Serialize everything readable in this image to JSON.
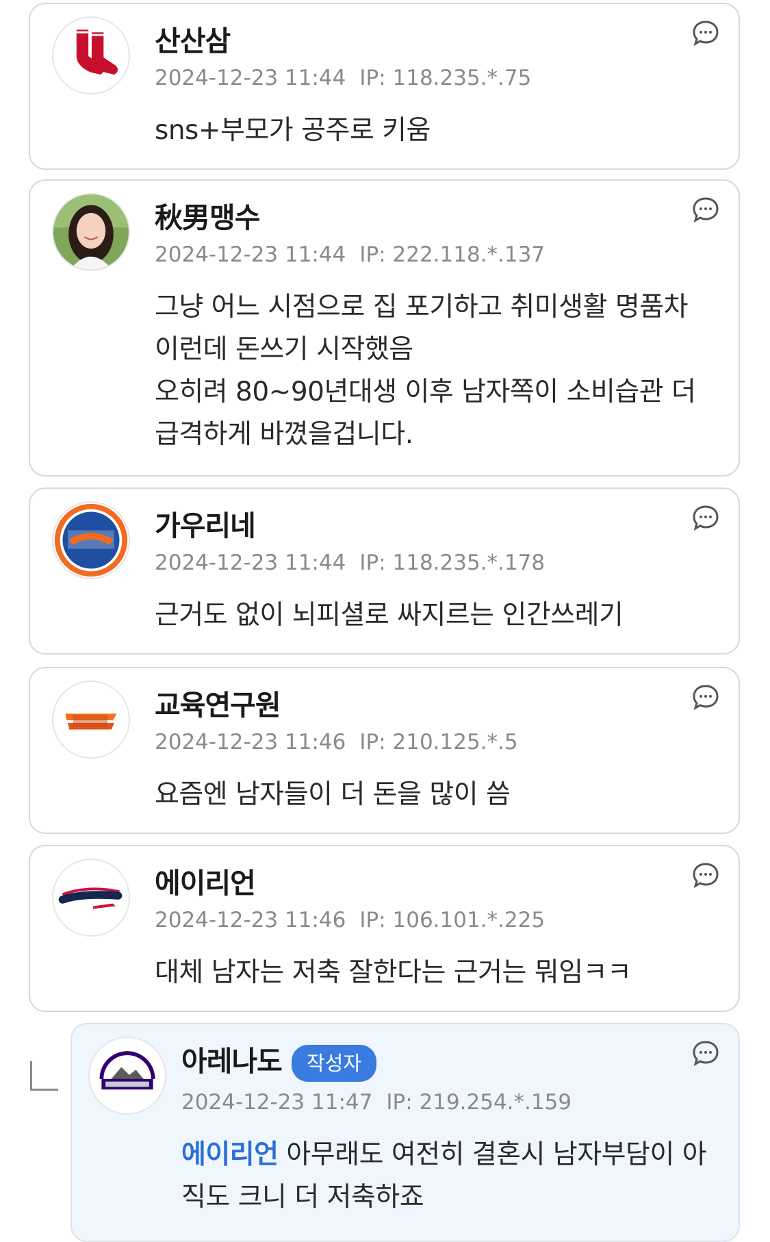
{
  "comments": [
    {
      "nickname": "산산삼",
      "date": "2024-12-23 11:44",
      "ip": "IP: 118.235.*.75",
      "text": "sns+부모가 공주로 키움",
      "avatar": "red-sox-logo"
    },
    {
      "nickname": "秋男맹수",
      "date": "2024-12-23 11:44",
      "ip": "IP: 222.118.*.137",
      "text": "그냥 어느 시점으로 집 포기하고 취미생활 명품차 이런데 돈쓰기 시작했음\n오히려 80~90년대생 이후 남자쪽이 소비습관 더 급격하게 바꼈을겁니다.",
      "avatar": "profile-photo"
    },
    {
      "nickname": "가우리네",
      "date": "2024-12-23 11:44",
      "ip": "IP: 118.235.*.178",
      "text": "근거도 없이 뇌피셜로 싸지르는 인간쓰레기",
      "avatar": "mets-logo"
    },
    {
      "nickname": "교육연구원",
      "date": "2024-12-23 11:46",
      "ip": "IP: 210.125.*.5",
      "text": "요즘엔 남자들이 더 돈을 많이 씀",
      "avatar": "eagles-logo"
    },
    {
      "nickname": "에이리언",
      "date": "2024-12-23 11:46",
      "ip": "IP: 106.101.*.225",
      "text": "대체 남자는 저축 잘한다는 근거는 뭐임ㅋㅋ",
      "avatar": "braves-logo"
    }
  ],
  "reply": {
    "nickname": "아레나도",
    "badge": "작성자",
    "date": "2024-12-23 11:47",
    "ip": "IP: 219.254.*.159",
    "mention": "에이리언",
    "text": " 아무래도 여전히 결혼시 남자부담이 아직도 크니 더 저축하죠",
    "avatar": "rockies-logo"
  },
  "icons": {
    "reply_button": "comment-bubble-icon",
    "reply_indicator": "reply-arrow-icon"
  },
  "colors": {
    "accent": "#3a7be0",
    "mention": "#2b6fd6",
    "reply_bg": "#f0f6fd"
  }
}
